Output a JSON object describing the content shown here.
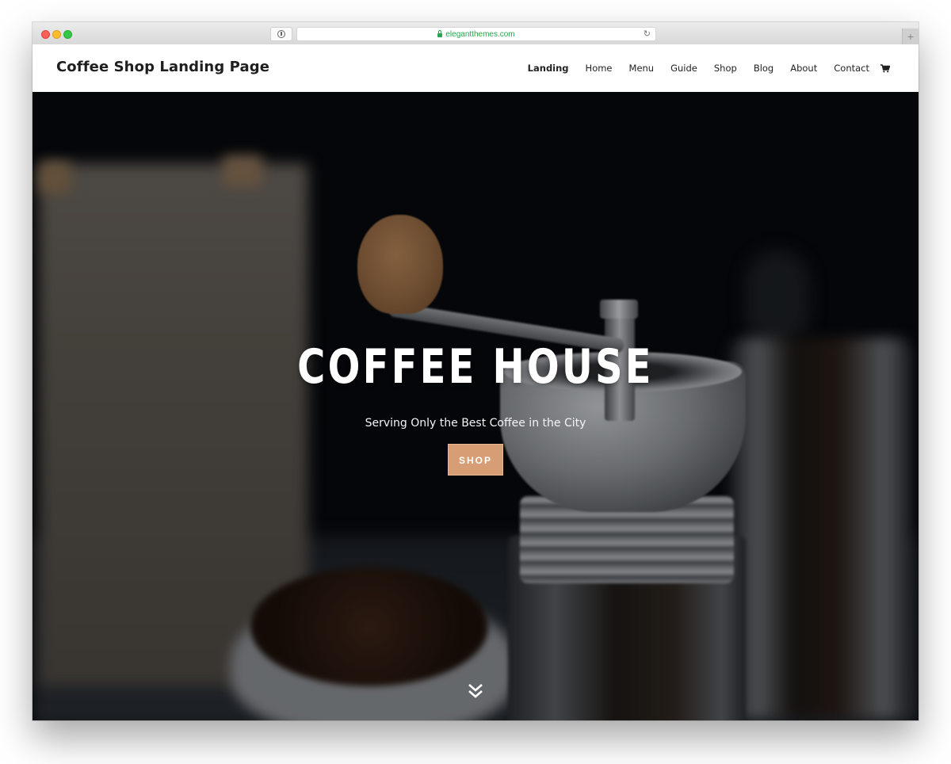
{
  "browser": {
    "url": "elegantthemes.com",
    "new_tab_label": "+",
    "reload_glyph": "↻"
  },
  "header": {
    "site_title": "Coffee Shop Landing Page",
    "nav": [
      {
        "label": "Landing",
        "active": true
      },
      {
        "label": "Home",
        "active": false
      },
      {
        "label": "Menu",
        "active": false
      },
      {
        "label": "Guide",
        "active": false
      },
      {
        "label": "Shop",
        "active": false
      },
      {
        "label": "Blog",
        "active": false
      },
      {
        "label": "About",
        "active": false
      },
      {
        "label": "Contact",
        "active": false
      }
    ],
    "cart_icon": "shopping-cart-icon"
  },
  "hero": {
    "title": "COFFEE HOUSE",
    "subtitle": "Serving Only the Best Coffee in the City",
    "cta_label": "SHOP",
    "scroll_icon": "double-chevron-down-icon"
  },
  "colors": {
    "accent": "#d79e75",
    "url_green": "#2aa44f",
    "header_text": "#1e1e1e",
    "hero_bg": "#07090d"
  }
}
